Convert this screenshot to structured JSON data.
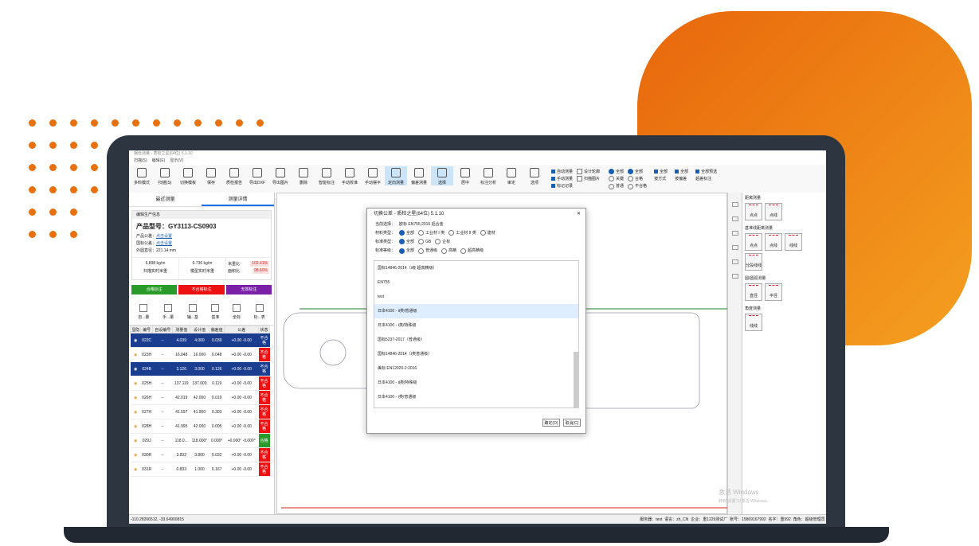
{
  "colors": {
    "accent": "#e8700e",
    "selected_row": "#1a3d8f",
    "fail": "#ee1111",
    "pass": "#2a9a2a",
    "qualified_btn": "#2a9a2a",
    "unqualified_btn": "#ee1111",
    "no_mark_btn": "#7a1fa6"
  },
  "window": {
    "title": "钢丝测量 - 质检之星(64位) 5.1.10",
    "menus": [
      "扫描(S)",
      "编辑(E)",
      "显示(V)"
    ]
  },
  "toolbar": {
    "buttons": [
      "多料模式",
      "扫描(S)",
      "切换模板",
      "保存",
      "质检报告",
      "导出DXF",
      "导出图片",
      "删除",
      "智能标注",
      "手动校准",
      "手动摆平",
      "定向测量",
      "偏差测量",
      "选择",
      "居中",
      "标注分析",
      "审定",
      "选项"
    ],
    "checks": [
      "自动测量",
      "手动测量",
      "标记记录",
      "设计轮廓",
      "扫描图片"
    ],
    "radios1": [
      "全部",
      "关键",
      "普通"
    ],
    "radios2": [
      "全部",
      "合格",
      "不合格"
    ],
    "selects": [
      {
        "check": "全部",
        "label": "按方式"
      },
      {
        "check": "全部",
        "label": "按偏差"
      },
      {
        "check": "全部预选",
        "label": "超差标注"
      }
    ]
  },
  "left": {
    "tabs": [
      "最近测量",
      "测量详情"
    ],
    "card_title": "编辑生产信息",
    "model_label": "产品型号：",
    "model": "GY3113-CS0903",
    "product_tol_label": "产品公差：",
    "product_tol_link": "点击设置",
    "national_tol_label": "国标公差：",
    "national_tol_link": "点击设置",
    "outer_label": "外圆直径：",
    "outer_value": "221.14 mm",
    "scan_weight": "6.898 kg/m",
    "scan_weight_label": "扫描实时米重",
    "model_weight": "6.736 kg/m",
    "model_weight_label": "模型实时米重",
    "ratio1_label": "米重比",
    "ratio1": "102.41%",
    "ratio2_label": "面积比",
    "ratio2": "98.60%",
    "mark_btns": [
      "合格标注",
      "不合格标注",
      "无效标注"
    ],
    "tools": [
      "自...量",
      "手...量",
      "辅...基",
      "基准",
      "坐标",
      "标...表"
    ],
    "columns": [
      "显隐",
      "编号",
      "自设编号",
      "测量值",
      "设计值",
      "偏差值",
      "公差",
      "状态"
    ],
    "rows": [
      {
        "id": "022C",
        "custom": "--",
        "measure": "4.039",
        "design": "4.000",
        "dev": "0.039",
        "tol": "+0.00 -0.00",
        "status": "不合格",
        "sel": true,
        "ok": false
      },
      {
        "id": "023H",
        "custom": "--",
        "measure": "16.048",
        "design": "16.000",
        "dev": "0.048",
        "tol": "+0.00 -0.00",
        "status": "不合格",
        "sel": false,
        "ok": false
      },
      {
        "id": "024B",
        "custom": "--",
        "measure": "3.126",
        "design": "3.000",
        "dev": "0.126",
        "tol": "+0.00 -0.00",
        "status": "不合格",
        "sel": true,
        "ok": false
      },
      {
        "id": "025H",
        "custom": "--",
        "measure": "137.119",
        "design": "137.000",
        "dev": "0.119",
        "tol": "+0.00 -0.00",
        "status": "不合格",
        "sel": false,
        "ok": false
      },
      {
        "id": "026H",
        "custom": "--",
        "measure": "42.019",
        "design": "42.000",
        "dev": "0.019",
        "tol": "+0.00 -0.00",
        "status": "不合格",
        "sel": false,
        "ok": false
      },
      {
        "id": "027H",
        "custom": "--",
        "measure": "41.597",
        "design": "41.900",
        "dev": "0.303",
        "tol": "+0.00 -0.00",
        "status": "不合格",
        "sel": false,
        "ok": false
      },
      {
        "id": "028H",
        "custom": "--",
        "measure": "41.995",
        "design": "42.000",
        "dev": "0.005",
        "tol": "+0.00 -0.00",
        "status": "不合格",
        "sel": false,
        "ok": false
      },
      {
        "id": "029J",
        "custom": "--",
        "measure": "118.0...",
        "design": "118.000°",
        "dev": "0.000°",
        "tol": "+0.000° -0.000°",
        "status": "合格",
        "sel": false,
        "ok": true
      },
      {
        "id": "030R",
        "custom": "--",
        "measure": "3.832",
        "design": "3.800",
        "dev": "0.032",
        "tol": "+0.00 -0.00",
        "status": "不合格",
        "sel": false,
        "ok": false
      },
      {
        "id": "031R",
        "custom": "--",
        "measure": "0.833",
        "design": "1.000",
        "dev": "0.167",
        "tol": "+0.00 -0.00",
        "status": "不合格",
        "sel": false,
        "ok": false
      }
    ]
  },
  "dialog": {
    "title": "切换公差 - 质检之星(64位) 5.1.10",
    "current_label": "当前选择：",
    "current": "欧标 EN755:2016 铝合金",
    "material_label": "材料类型：",
    "materials": [
      "全部",
      "工业材 I 类",
      "工业材 II 类",
      "建材"
    ],
    "standard_label": "标准类型：",
    "standards": [
      "全部",
      "GB",
      "企标"
    ],
    "grade_label": "标准等级：",
    "grades": [
      "全部",
      "普通级",
      "高精",
      "超高精级"
    ],
    "items": [
      "国标14846-2014（Ⅰ级 超高精级）",
      "EN755",
      "test",
      "日本4100 - Ⅱ类/普通级",
      "日本4100 - Ⅰ类/特殊级",
      "国标5237-2017（普通级）",
      "国标14846-2014（Ⅰ类普通级）",
      "美标 EN12020-2:2016",
      "日本4100 - Ⅱ类/特殊级",
      "日本4100 - Ⅰ类/普通级"
    ],
    "ok": "确定(O)",
    "cancel": "取消(C)"
  },
  "right": {
    "sec1": "距离测量",
    "sec1_btns": [
      "点点",
      "点线"
    ],
    "sec2": "基准线距离测量",
    "sec2_btns": [
      "点点",
      "点线",
      "线线"
    ],
    "sec2_extra": "分段线线",
    "sec3": "圆/圆弧测量",
    "sec3_btns": [
      "直径",
      "半径"
    ],
    "sec4": "角度测量",
    "sec4_btns": [
      "线线"
    ]
  },
  "status": {
    "coords": "-110.28266512, -33.64900815",
    "server": "服务器：test",
    "lang": "语言：zh_CN",
    "company": "企业：重1229测试厂",
    "account": "账号：15869167992",
    "name": "名字：重992",
    "role": "角色：超级管理员"
  },
  "watermark": {
    "line1": "激活 Windows",
    "line2": "转到\"设置\"以激活 Windows。"
  }
}
